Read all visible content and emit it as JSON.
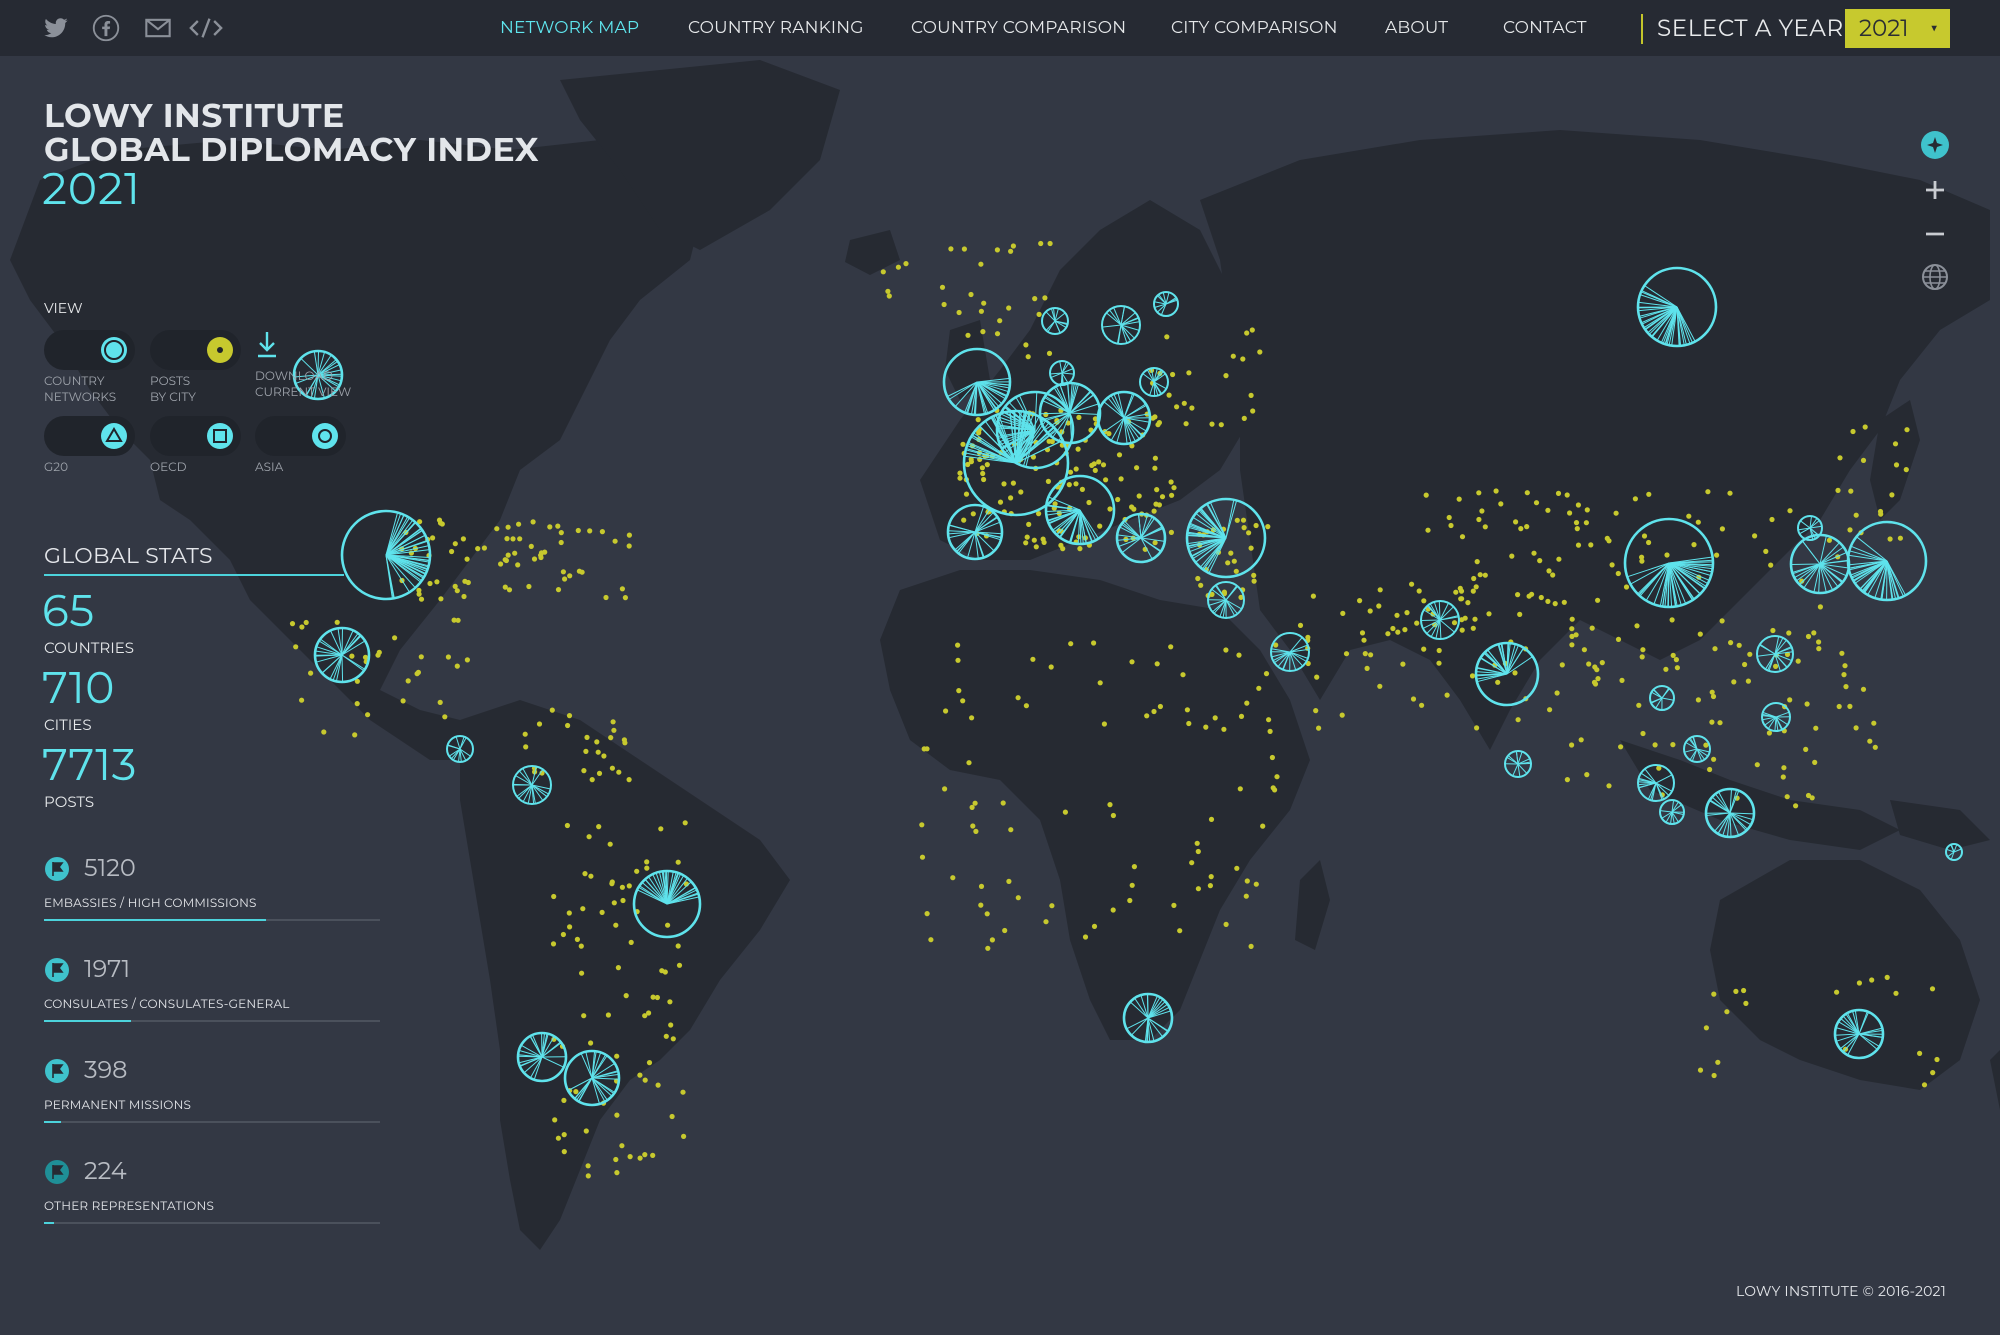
{
  "nav": {
    "items": [
      {
        "label": "NETWORK MAP",
        "active": true
      },
      {
        "label": "COUNTRY RANKING",
        "active": false
      },
      {
        "label": "COUNTRY COMPARISON",
        "active": false
      },
      {
        "label": "CITY COMPARISON",
        "active": false
      },
      {
        "label": "ABOUT",
        "active": false
      },
      {
        "label": "CONTACT",
        "active": false
      }
    ],
    "social_icons": [
      "twitter-icon",
      "facebook-icon",
      "email-icon",
      "embed-code-icon"
    ],
    "year_label": "SELECT A YEAR",
    "year_value": "2021"
  },
  "title": {
    "line1": "LOWY INSTITUTE",
    "line2": "GLOBAL DIPLOMACY INDEX",
    "year": "2021"
  },
  "view": {
    "label": "VIEW",
    "toggles": [
      {
        "line1": "COUNTRY",
        "line2": "NETWORKS",
        "icon": "circle-icon",
        "color": "#5fe3ec"
      },
      {
        "line1": "POSTS",
        "line2": "BY CITY",
        "icon": "dot-icon",
        "color": "#c7c92e"
      },
      {
        "line1": "G20",
        "line2": "",
        "icon": "triangle-icon",
        "color": "#5fe3ec"
      },
      {
        "line1": "OECD",
        "line2": "",
        "icon": "square-icon",
        "color": "#5fe3ec"
      },
      {
        "line1": "ASIA",
        "line2": "",
        "icon": "circle-icon",
        "color": "#5fe3ec"
      }
    ],
    "download_line1": "DOWNLOAD",
    "download_line2": "CURRENT VIEW"
  },
  "global_stats": {
    "title": "GLOBAL STATS",
    "countries": "65",
    "countries_label": "COUNTRIES",
    "cities": "710",
    "cities_label": "CITIES",
    "posts": "7713",
    "posts_label": "POSTS"
  },
  "post_types": [
    {
      "count": "5120",
      "label": "EMBASSIES / HIGH COMMISSIONS",
      "fraction": 0.66
    },
    {
      "count": "1971",
      "label": "CONSULATES / CONSULATES-GENERAL",
      "fraction": 0.26
    },
    {
      "count": "398",
      "label": "PERMANENT MISSIONS",
      "fraction": 0.05
    },
    {
      "count": "224",
      "label": "OTHER REPRESENTATIONS",
      "fraction": 0.03
    }
  ],
  "map_controls": [
    "reset-view-icon",
    "zoom-in-icon",
    "zoom-out-icon",
    "globe-icon"
  ],
  "copyright": "LOWY INSTITUTE © 2016-2021",
  "colors": {
    "background": "#333844",
    "land": "#262a32",
    "accent_cyan": "#5fe3ec",
    "accent_yellow": "#c7c92e"
  }
}
